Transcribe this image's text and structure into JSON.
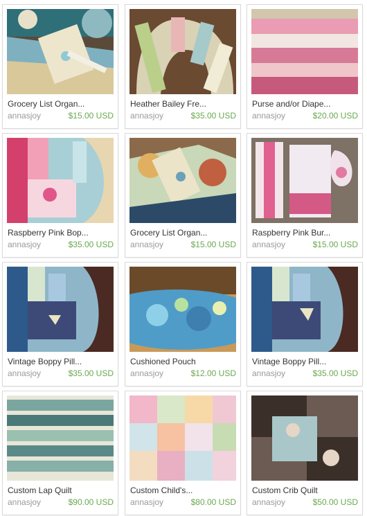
{
  "listings": [
    {
      "title": "Grocery List Organ...",
      "shop": "annasjoy",
      "price": "$15.00 USD",
      "image": "grocery-list-organizer-photo"
    },
    {
      "title": "Heather Bailey Fre...",
      "shop": "annasjoy",
      "price": "$35.00 USD",
      "image": "boppy-pillow-cover-photo"
    },
    {
      "title": "Purse and/or Diape...",
      "shop": "annasjoy",
      "price": "$20.00 USD",
      "image": "ruffled-purse-photo"
    },
    {
      "title": "Raspberry Pink Bop...",
      "shop": "annasjoy",
      "price": "$35.00 USD",
      "image": "raspberry-boppy-photo"
    },
    {
      "title": "Grocery List Organ...",
      "shop": "annasjoy",
      "price": "$15.00 USD",
      "image": "grocery-list-organizer-photo"
    },
    {
      "title": "Raspberry Pink Bur...",
      "shop": "annasjoy",
      "price": "$15.00 USD",
      "image": "burp-cloth-bib-photo"
    },
    {
      "title": "Vintage Boppy Pill...",
      "shop": "annasjoy",
      "price": "$35.00 USD",
      "image": "vintage-boppy-photo"
    },
    {
      "title": "Cushioned Pouch",
      "shop": "annasjoy",
      "price": "$12.00 USD",
      "image": "cushioned-pouch-photo"
    },
    {
      "title": "Vintage Boppy Pill...",
      "shop": "annasjoy",
      "price": "$35.00 USD",
      "image": "vintage-boppy-photo"
    },
    {
      "title": "Custom Lap Quilt",
      "shop": "annasjoy",
      "price": "$90.00 USD",
      "image": "lap-quilt-photo"
    },
    {
      "title": "Custom Child's...",
      "shop": "annasjoy",
      "price": "$80.00 USD",
      "image": "child-quilt-photo"
    },
    {
      "title": "Custom Crib Quilt",
      "shop": "annasjoy",
      "price": "$50.00 USD",
      "image": "crib-quilt-photo"
    }
  ],
  "colors": {
    "price": "#6aa84f",
    "shop": "#999999",
    "title": "#333333",
    "card_border": "#d9d9d9"
  }
}
